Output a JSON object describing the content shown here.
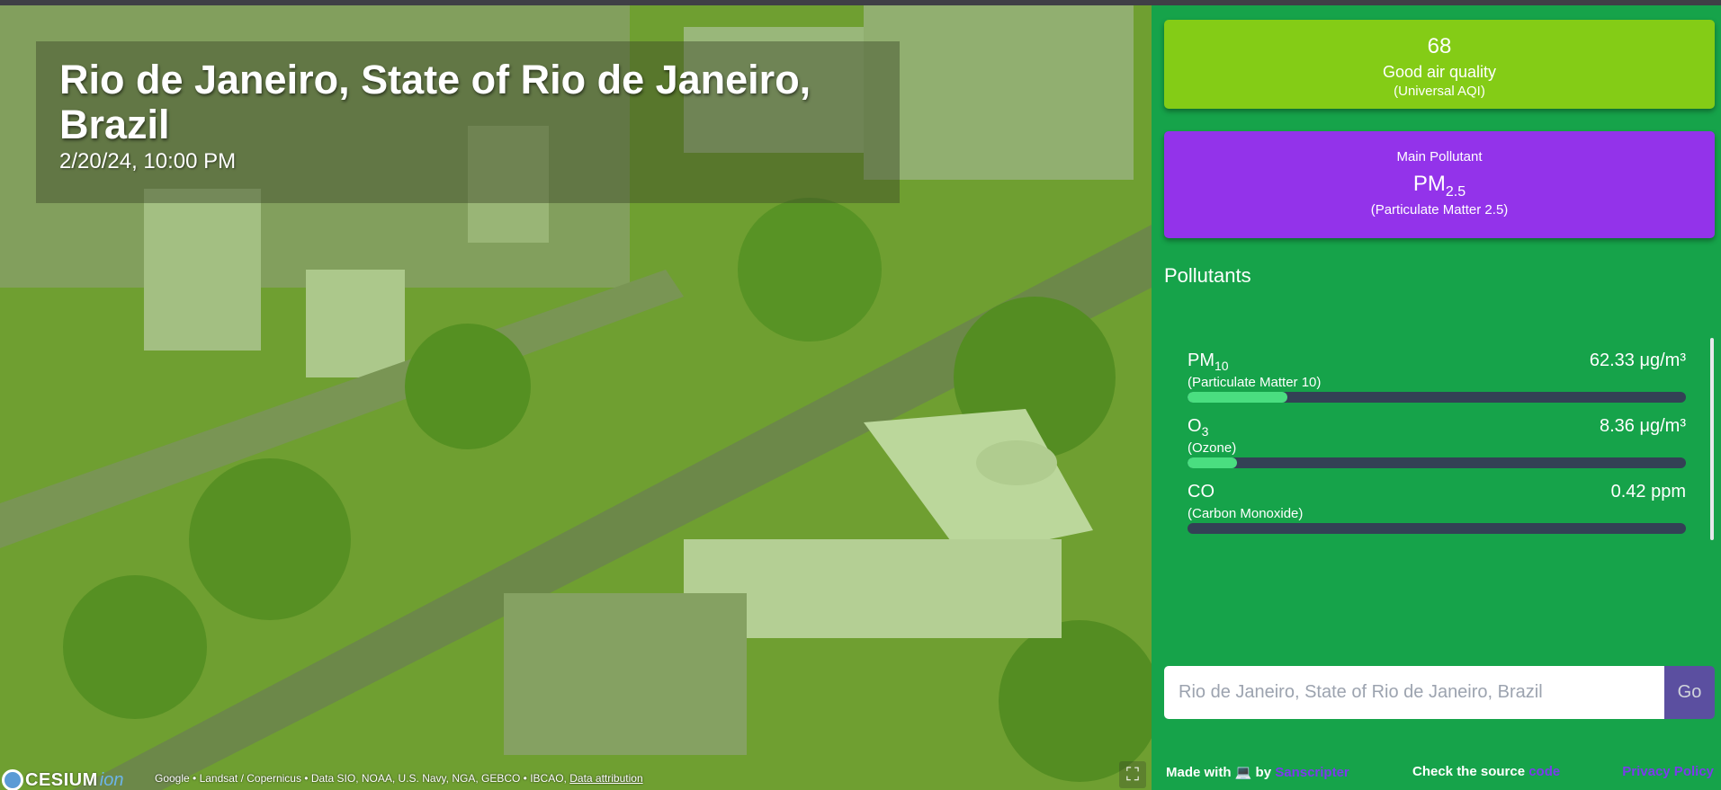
{
  "map": {
    "title": "Rio de Janeiro, State of Rio de Janeiro, Brazil",
    "datetime": "2/20/24, 10:00 PM",
    "logo_text": "CESIUM",
    "logo_ion": "ion",
    "credits": "Google • Landsat / Copernicus • Data SIO, NOAA, U.S. Navy, NGA, GEBCO • IBCAO,",
    "credits_link": "Data attribution",
    "fullscreen_icon": "fullscreen-icon"
  },
  "aqi": {
    "value": "68",
    "description": "Good air quality",
    "scale": "(Universal AQI)",
    "color": "#84cc16"
  },
  "main_pollutant": {
    "label": "Main Pollutant",
    "symbol": "PM",
    "symbol_sub": "2.5",
    "name": "(Particulate Matter 2.5)",
    "color": "#9333ea"
  },
  "pollutants": {
    "title": "Pollutants",
    "items": [
      {
        "symbol": "PM",
        "sub": "10",
        "full": "(Particulate Matter 10)",
        "value": "62.33 μg/m³",
        "level": 0.2
      },
      {
        "symbol": "O",
        "sub": "3",
        "full": "(Ozone)",
        "value": "8.36 μg/m³",
        "level": 0.1
      },
      {
        "symbol": "CO",
        "sub": "",
        "full": "(Carbon Monoxide)",
        "value": "0.42 ppm",
        "level": 0.0
      }
    ]
  },
  "search": {
    "placeholder": "Rio de Janeiro, State of Rio de Janeiro, Brazil",
    "button": "Go"
  },
  "footer": {
    "made_with": "Made with",
    "laptop": "💻",
    "by": "by",
    "author": "Sanscripter",
    "check_source": "Check the source",
    "code": "code",
    "privacy": "Privacy Policy"
  },
  "colors": {
    "panel": "#16a34a",
    "bar_track": "#334155",
    "bar_fill": "#4ade80",
    "link": "#7c3aed"
  }
}
